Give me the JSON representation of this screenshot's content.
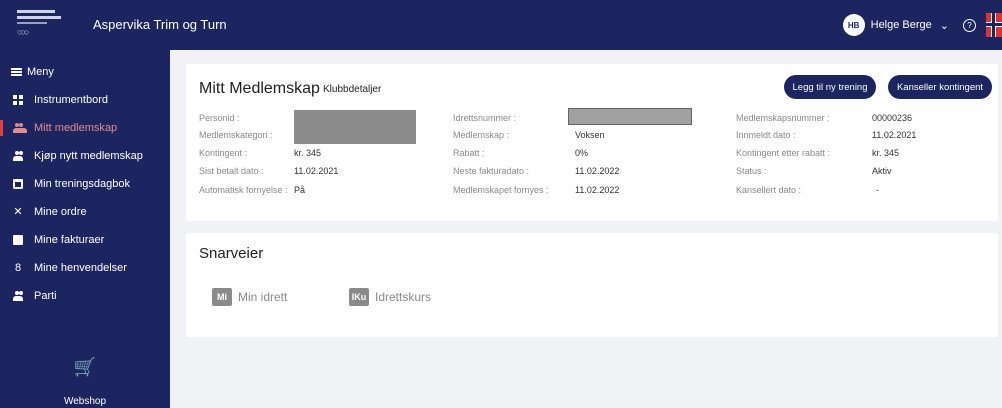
{
  "header": {
    "club_name": "Aspervika Trim og Turn",
    "user_initials": "HB",
    "user_name": "Helge Berge",
    "chevron": "⌄",
    "help_symbol": "?"
  },
  "sidebar": {
    "menu_label": "Meny",
    "items": [
      {
        "label": "Instrumentbord",
        "icon": "dashboard-icon"
      },
      {
        "label": "Mitt medlemskap",
        "icon": "members-icon",
        "active": true
      },
      {
        "label": "Kjøp nytt medlemskap",
        "icon": "members-icon"
      },
      {
        "label": "Min treningsdagbok",
        "icon": "calendar-icon"
      },
      {
        "label": "Mine ordre",
        "icon": "cart-icon"
      },
      {
        "label": "Mine fakturaer",
        "icon": "receipt-icon"
      },
      {
        "label": "Mine henvendelser",
        "icon": "inquiry-icon"
      },
      {
        "label": "Parti",
        "icon": "group-icon"
      }
    ],
    "webshop_label": "Webshop",
    "webshop_icon": "🛒"
  },
  "membership": {
    "title": "Mitt Medlemskap",
    "subtitle": "Klubbdetaljer",
    "btn_training": "Legg til ny trening",
    "btn_cancel": "Kanseller kontingent",
    "col1": {
      "personid_label": "Personid :",
      "category_label": "Medlemskategori :",
      "fee_label": "Kontingent :",
      "fee_value": "kr. 345",
      "last_paid_label": "Sist betalt dato :",
      "last_paid_value": "11.02.2021",
      "auto_renew_label": "Automatisk fornyelse :",
      "auto_renew_value": "På"
    },
    "col2": {
      "sport_number_label": "Idrettsnummer :",
      "membership_label": "Medlemskap :",
      "membership_value": "Voksen",
      "discount_label": "Rabatt :",
      "discount_value": "0%",
      "next_invoice_label": "Neste fakturadato :",
      "next_invoice_value": "11.02.2022",
      "renewed_label": "Medlemskapet fornyes :",
      "renewed_value": "11.02.2022"
    },
    "col3": {
      "member_number_label": "Medlemskapsnummer :",
      "member_number_value": "00000236",
      "joined_label": "Innmeldt dato :",
      "joined_value": "11.02.2021",
      "fee_after_label": "Kontingent etter rabatt :",
      "fee_after_value": "kr. 345",
      "status_label": "Status :",
      "status_value": "Aktiv",
      "cancelled_label": "Kansellert dato :",
      "cancelled_value": "-"
    }
  },
  "shortcuts": {
    "title": "Snarveier",
    "items": [
      {
        "badge": "Mi",
        "label": "Min idrett"
      },
      {
        "badge": "IKu",
        "label": "Idrettskurs"
      }
    ]
  },
  "colors": {
    "navy": "#1d2561",
    "active_red": "#e04040"
  }
}
